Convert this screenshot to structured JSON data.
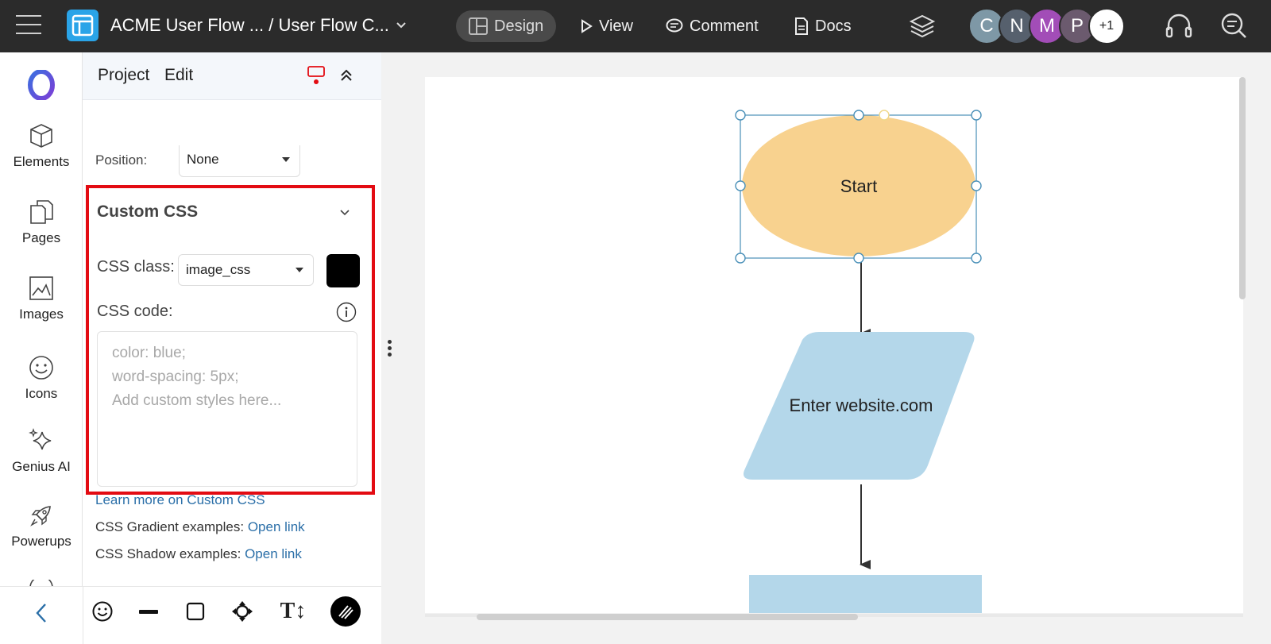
{
  "header": {
    "doc_title": "ACME User Flow ... / User Flow C...",
    "nav": {
      "design": "Design",
      "view": "View",
      "comment": "Comment",
      "docs": "Docs"
    },
    "avatars": [
      "C",
      "N",
      "M",
      "P",
      "+1"
    ]
  },
  "rail": {
    "items": [
      {
        "label": "Elements",
        "icon": "cube-icon"
      },
      {
        "label": "Pages",
        "icon": "pages-icon"
      },
      {
        "label": "Images",
        "icon": "image-icon"
      },
      {
        "label": "Icons",
        "icon": "smiley-icon"
      },
      {
        "label": "Genius AI",
        "icon": "sparkle-icon"
      },
      {
        "label": "Powerups",
        "icon": "rocket-icon"
      }
    ]
  },
  "panel": {
    "tabs": {
      "project": "Project",
      "edit": "Edit"
    },
    "position": {
      "label": "Position:",
      "value": "None"
    },
    "custom_css": {
      "header": "Custom CSS",
      "css_class_label": "CSS class:",
      "css_class_value": "image_css",
      "swatch_color": "#000000",
      "css_code_label": "CSS code:",
      "code_placeholder_lines": [
        "color: blue;",
        "word-spacing: 5px;",
        "Add custom styles here..."
      ],
      "highlight_color": "#e30b12"
    },
    "learn_more": "Learn more on Custom CSS",
    "gradient_examples": {
      "label": "CSS Gradient examples:",
      "link": "Open link"
    },
    "shadow_examples": {
      "label": "CSS Shadow examples:",
      "link": "Open link"
    }
  },
  "flowchart": {
    "shapes": [
      {
        "type": "ellipse",
        "label": "Start",
        "fill": "#f8d28f",
        "selected": true
      },
      {
        "type": "parallelogram",
        "label": "Enter website.com",
        "fill": "#b4d7ea"
      },
      {
        "type": "rectangle",
        "label": "",
        "fill": "#b4d7ea"
      }
    ],
    "selection_color": "#4a90b8"
  },
  "colors": {
    "topbar": "#2b2b2b",
    "accent_link": "#2b6fa8"
  }
}
